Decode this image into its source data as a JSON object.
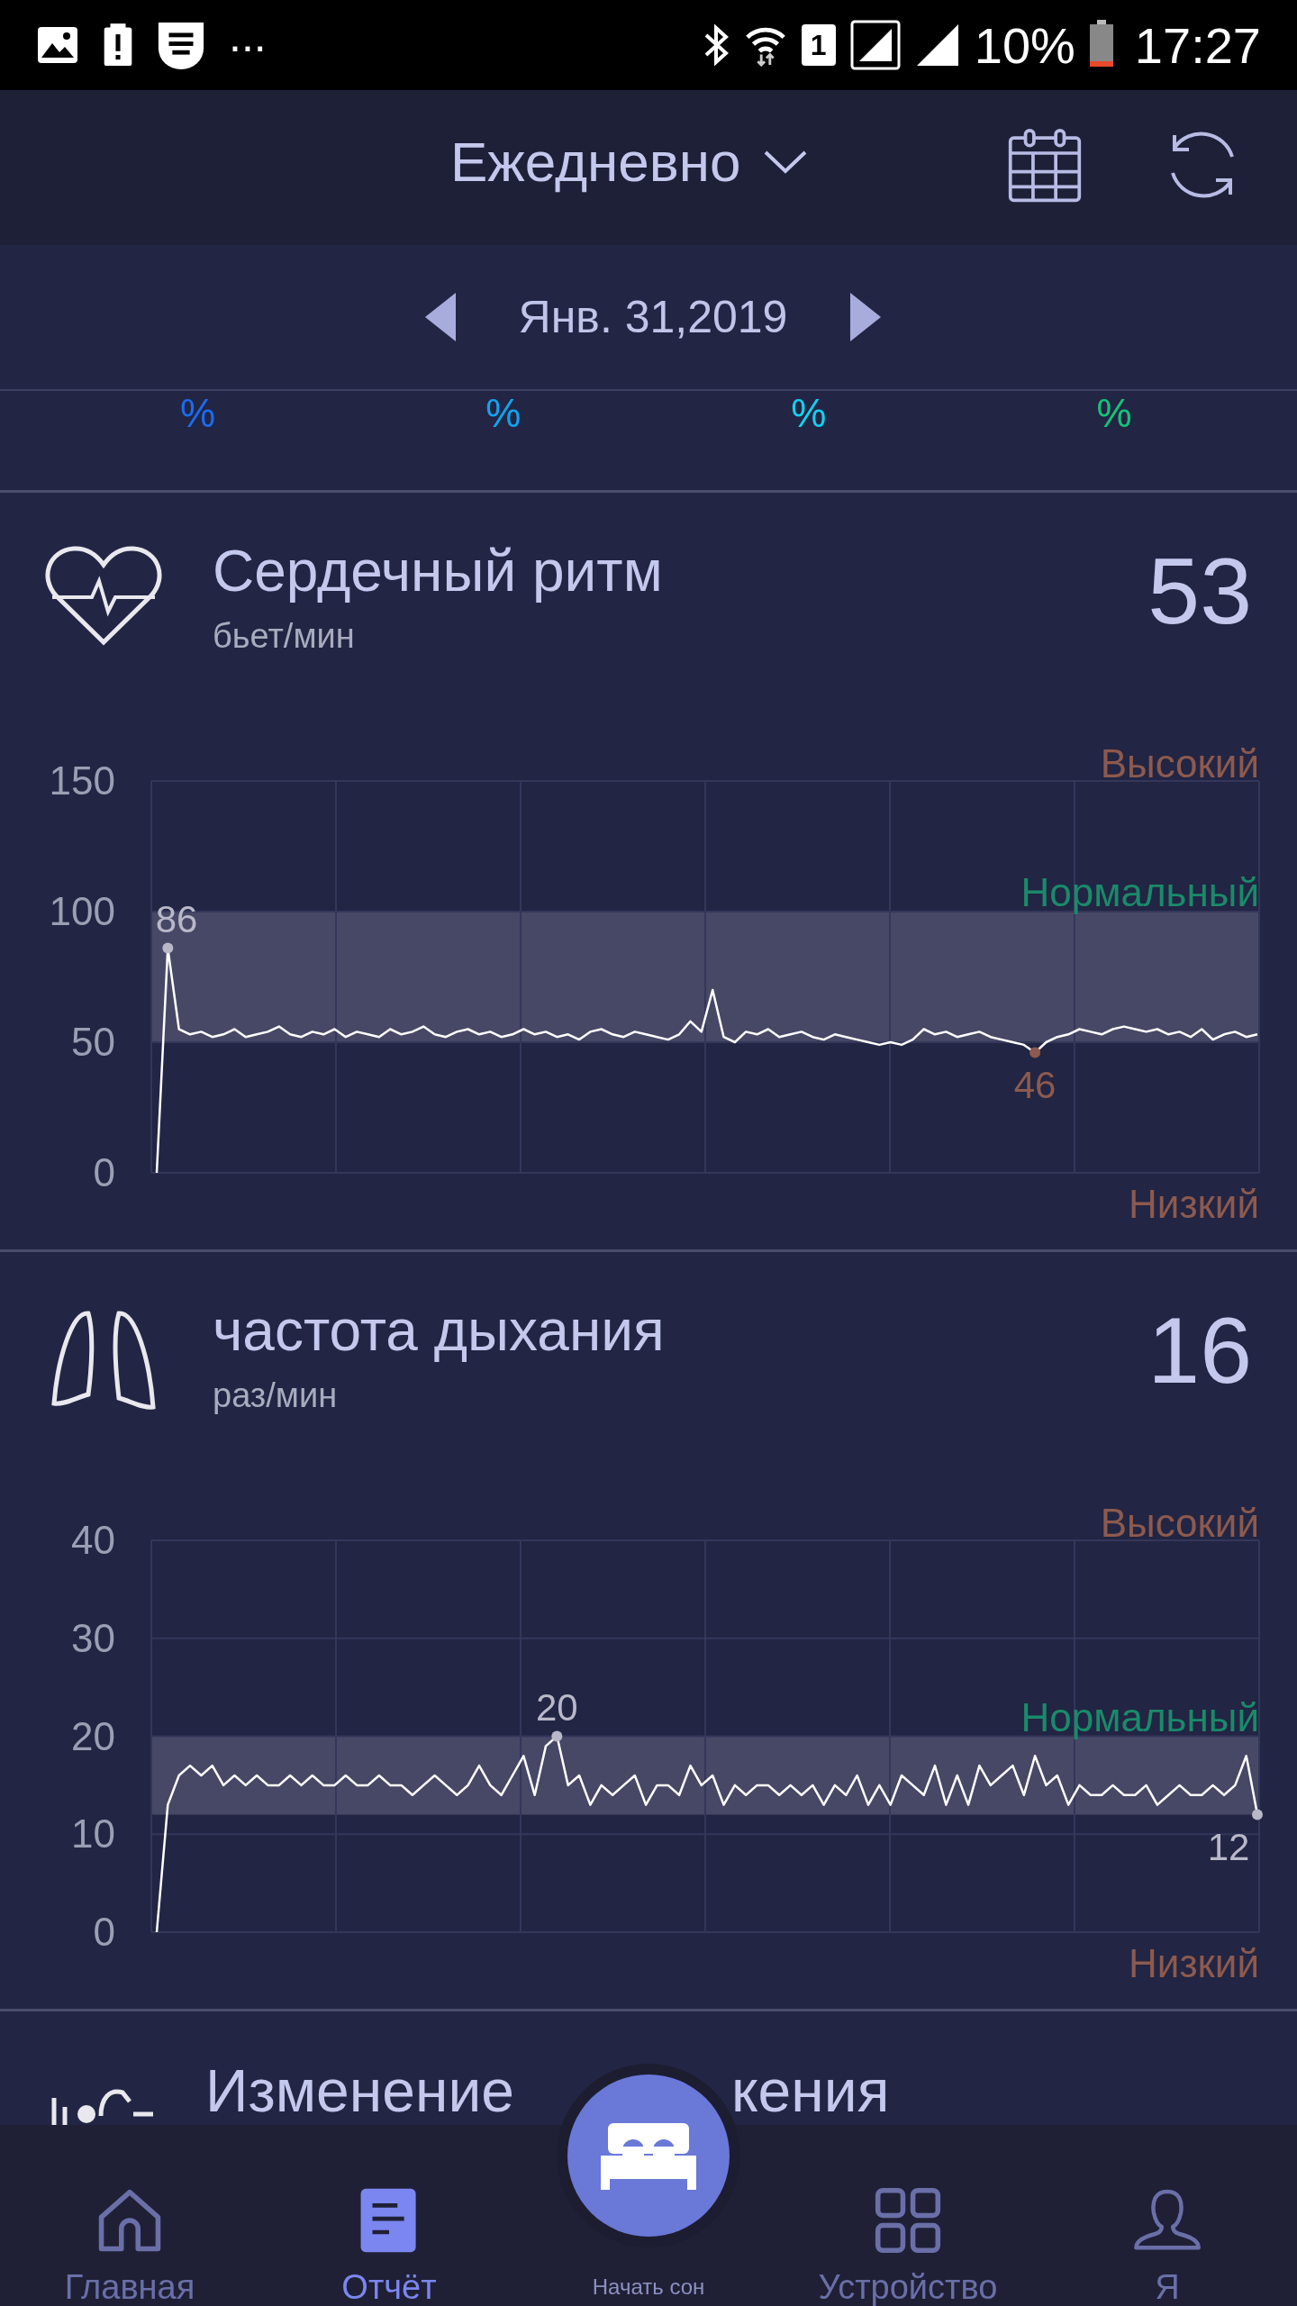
{
  "status_bar": {
    "more": "...",
    "sim": "1",
    "battery_text": "10%",
    "time": "17:27"
  },
  "header": {
    "title": "Ежедневно"
  },
  "date_nav": {
    "date": "Янв. 31,2019"
  },
  "percent_row": [
    {
      "text": "%",
      "color": "#1a6cf0"
    },
    {
      "text": "%",
      "color": "#12a3f0"
    },
    {
      "text": "%",
      "color": "#14d0f0"
    },
    {
      "text": "%",
      "color": "#14c47a"
    }
  ],
  "sections": [
    {
      "kind": "heart",
      "title": "Сердечный ритм",
      "unit": "бьет/мин",
      "value": "53",
      "zones": {
        "high": "Высокий",
        "normal": "Нормальный",
        "low": "Низкий"
      },
      "point_labels": [
        {
          "text": "86",
          "kind": "max",
          "color": "#b8b8c8"
        },
        {
          "text": "46",
          "kind": "min",
          "color": "#8c5a4e"
        }
      ],
      "chart_data": {
        "type": "line",
        "ylim": [
          0,
          150
        ],
        "yticks": [
          0,
          50,
          100,
          150
        ],
        "grid": true,
        "bands": [
          {
            "axis": "y",
            "from": 50,
            "to": 100
          }
        ],
        "series": [
          {
            "color": "#ffffff",
            "values": [
              0,
              86,
              55,
              53,
              54,
              52,
              53,
              55,
              52,
              53,
              54,
              56,
              53,
              52,
              54,
              53,
              55,
              52,
              54,
              53,
              52,
              55,
              53,
              54,
              56,
              53,
              52,
              54,
              55,
              53,
              54,
              52,
              53,
              55,
              53,
              54,
              52,
              53,
              51,
              54,
              55,
              53,
              52,
              54,
              53,
              52,
              51,
              53,
              58,
              54,
              70,
              52,
              50,
              54,
              53,
              55,
              52,
              53,
              54,
              52,
              51,
              53,
              52,
              51,
              50,
              49,
              50,
              49,
              51,
              55,
              53,
              54,
              52,
              53,
              54,
              52,
              51,
              50,
              49,
              46,
              50,
              52,
              53,
              55,
              54,
              53,
              55,
              56,
              55,
              54,
              55,
              53,
              54,
              52,
              55,
              51,
              53,
              54,
              52,
              53
            ]
          }
        ]
      }
    },
    {
      "kind": "lungs",
      "title": "частота дыхания",
      "unit": "раз/мин",
      "value": "16",
      "zones": {
        "high": "Высокий",
        "normal": "Нормальный",
        "low": "Низкий"
      },
      "point_labels": [
        {
          "text": "20",
          "kind": "max",
          "color": "#b8b8c8"
        },
        {
          "text": "12",
          "kind": "min",
          "color": "#b8b8c8"
        }
      ],
      "chart_data": {
        "type": "line",
        "ylim": [
          0,
          40
        ],
        "yticks": [
          0,
          10,
          20,
          30,
          40
        ],
        "grid": true,
        "bands": [
          {
            "axis": "y",
            "from": 12,
            "to": 20
          }
        ],
        "series": [
          {
            "color": "#ffffff",
            "values": [
              0,
              13,
              16,
              17,
              16,
              17,
              15,
              16,
              15,
              16,
              15,
              15,
              16,
              15,
              16,
              15,
              15,
              16,
              15,
              15,
              16,
              15,
              15,
              14,
              15,
              16,
              15,
              14,
              15,
              17,
              15,
              14,
              16,
              18,
              14,
              19,
              20,
              15,
              16,
              13,
              15,
              14,
              15,
              16,
              13,
              15,
              15,
              14,
              17,
              15,
              16,
              13,
              15,
              14,
              15,
              15,
              14,
              15,
              14,
              15,
              13,
              15,
              14,
              16,
              13,
              15,
              13,
              16,
              15,
              14,
              17,
              13,
              16,
              13,
              17,
              15,
              16,
              17,
              14,
              18,
              15,
              16,
              13,
              15,
              14,
              14,
              15,
              14,
              14,
              15,
              13,
              14,
              15,
              14,
              14,
              15,
              14,
              15,
              18,
              12
            ]
          }
        ]
      }
    }
  ],
  "partial_section": {
    "title_start": "Изменение",
    "title_end": "кения"
  },
  "nav": [
    {
      "kind": "home",
      "label": "Главная",
      "selected": false
    },
    {
      "kind": "report",
      "label": "Отчёт",
      "selected": true
    },
    {
      "kind": "sleep",
      "label": "Начать сон",
      "selected": false
    },
    {
      "kind": "device",
      "label": "Устройство",
      "selected": false
    },
    {
      "kind": "profile",
      "label": "Я",
      "selected": false
    }
  ]
}
